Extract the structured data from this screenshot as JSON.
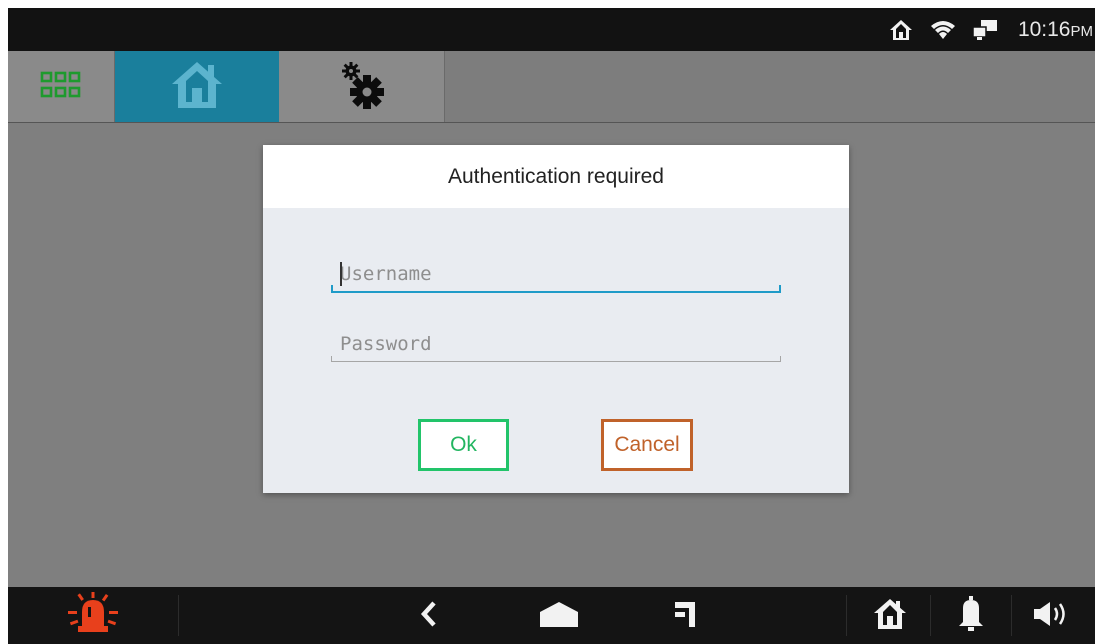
{
  "status_bar": {
    "time": "10:16",
    "ampm": "PM",
    "icons": [
      "home-icon",
      "wifi-icon",
      "network-icon"
    ]
  },
  "tabs": [
    {
      "name": "apps",
      "icon": "apps-grid-icon",
      "selected": false
    },
    {
      "name": "home",
      "icon": "home-icon",
      "selected": true
    },
    {
      "name": "settings",
      "icon": "gears-icon",
      "selected": false
    }
  ],
  "dialog": {
    "title": "Authentication required",
    "username_placeholder": "Username",
    "password_placeholder": "Password",
    "ok_label": "Ok",
    "cancel_label": "Cancel"
  },
  "nav_bar": {
    "icons": [
      "alarm-siren-icon",
      "back-icon",
      "home-icon",
      "recent-apps-icon",
      "home-icon",
      "bell-icon",
      "volume-icon"
    ]
  },
  "colors": {
    "accent_tab": "#1a7f9c",
    "ok_border": "#22c46a",
    "cancel_border": "#c0622a",
    "focus_underline": "#1f9bc8",
    "alarm": "#e8401c"
  }
}
